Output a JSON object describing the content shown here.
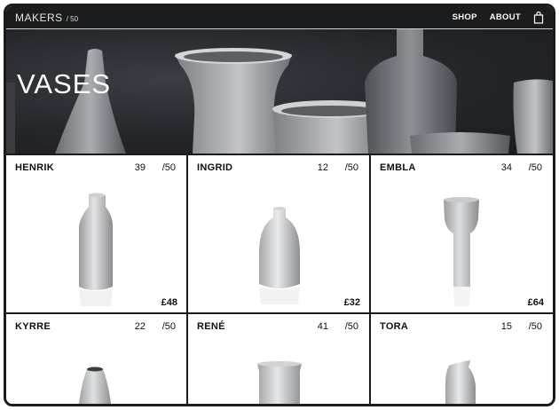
{
  "nav": {
    "brand": "MAKERS",
    "brand_suffix": "/ 50",
    "links": [
      "SHOP",
      "ABOUT"
    ],
    "cart_icon": "shopping-bag-icon"
  },
  "hero": {
    "title": "VASES"
  },
  "products": [
    {
      "name": "HENRIK",
      "number": "39",
      "total": "/50",
      "price": "£48"
    },
    {
      "name": "INGRID",
      "number": "12",
      "total": "/50",
      "price": "£32"
    },
    {
      "name": "EMBLA",
      "number": "34",
      "total": "/50",
      "price": "£64"
    },
    {
      "name": "KYRRE",
      "number": "22",
      "total": "/50",
      "price": ""
    },
    {
      "name": "RENÉ",
      "number": "41",
      "total": "/50",
      "price": ""
    },
    {
      "name": "TORA",
      "number": "15",
      "total": "/50",
      "price": ""
    }
  ]
}
